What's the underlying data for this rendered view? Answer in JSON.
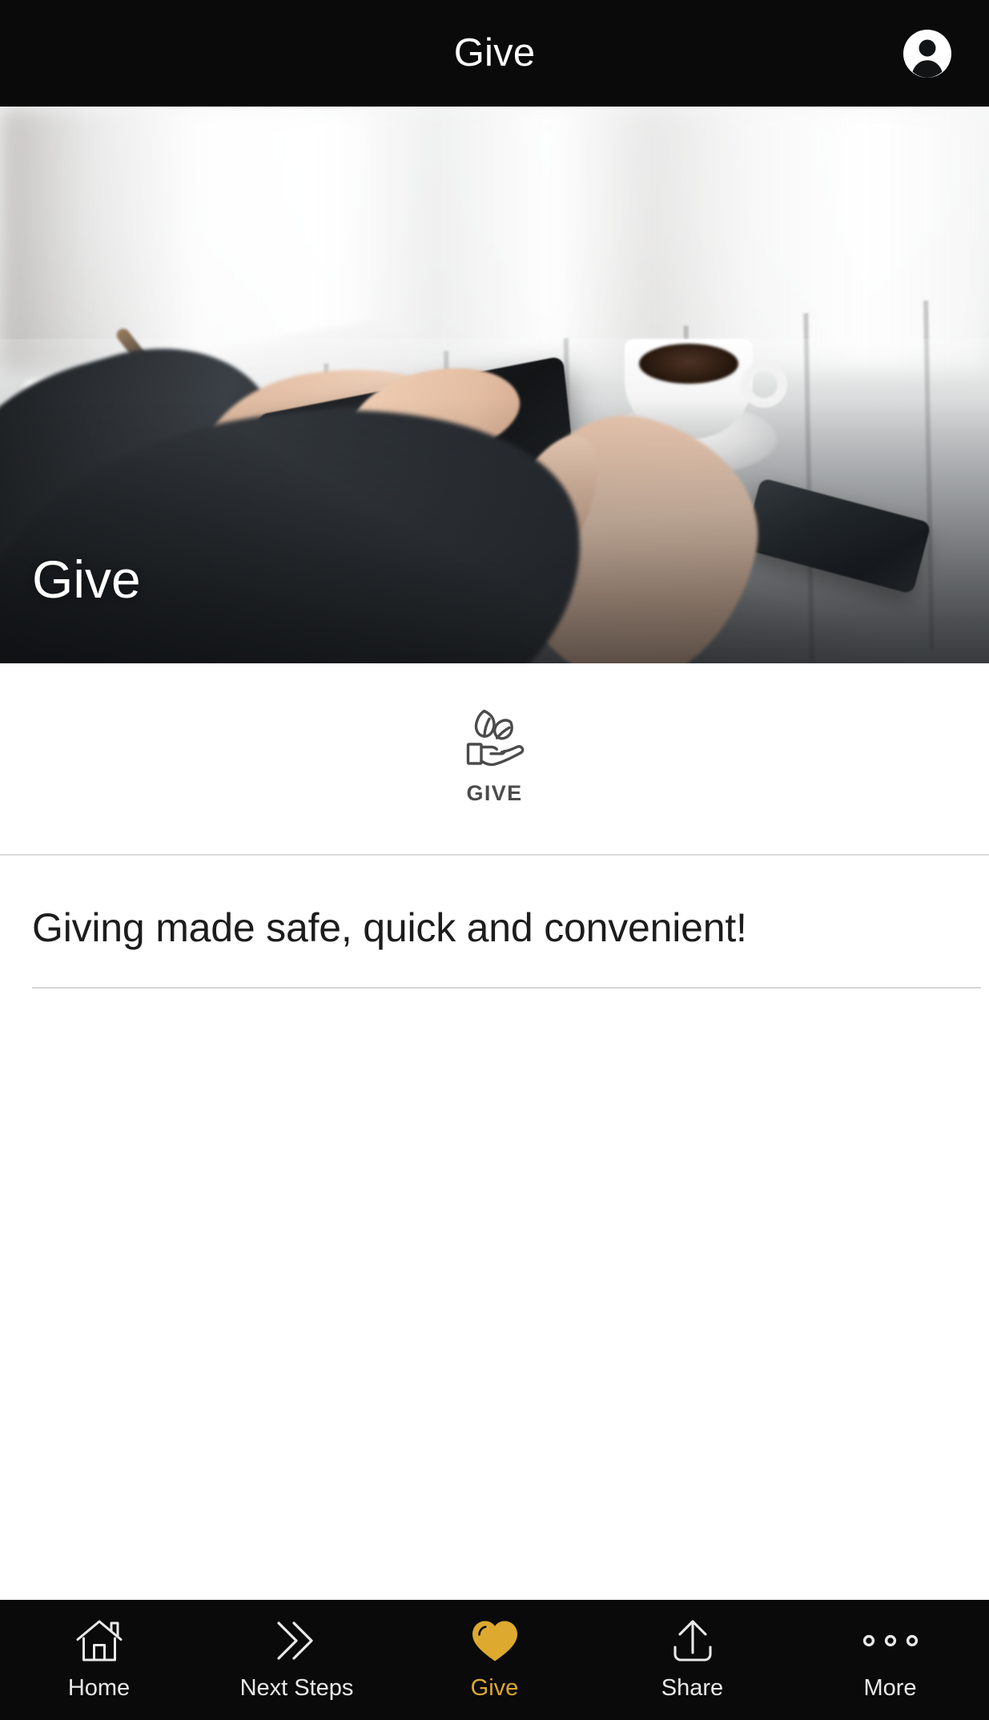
{
  "header": {
    "title": "Give",
    "avatar_icon": "user-avatar-icon"
  },
  "hero": {
    "caption": "Give",
    "image_description": "Blurred photo of hands holding a tablet on a grey wooden desk with a coffee cup and a smartphone"
  },
  "give_section": {
    "icon": "hand-with-sprout-icon",
    "label": "GIVE"
  },
  "content": {
    "heading": "Giving made safe, quick and convenient!"
  },
  "tabbar": {
    "active_color": "#dda92f",
    "inactive_color": "#e9e9e9",
    "background": "#0a0a0a",
    "items": [
      {
        "label": "Home",
        "icon": "home-icon",
        "active": false
      },
      {
        "label": "Next Steps",
        "icon": "double-chevron-icon",
        "active": false
      },
      {
        "label": "Give",
        "icon": "heart-icon",
        "active": true
      },
      {
        "label": "Share",
        "icon": "share-upload-icon",
        "active": false
      },
      {
        "label": "More",
        "icon": "ellipsis-icon",
        "active": false
      }
    ]
  }
}
